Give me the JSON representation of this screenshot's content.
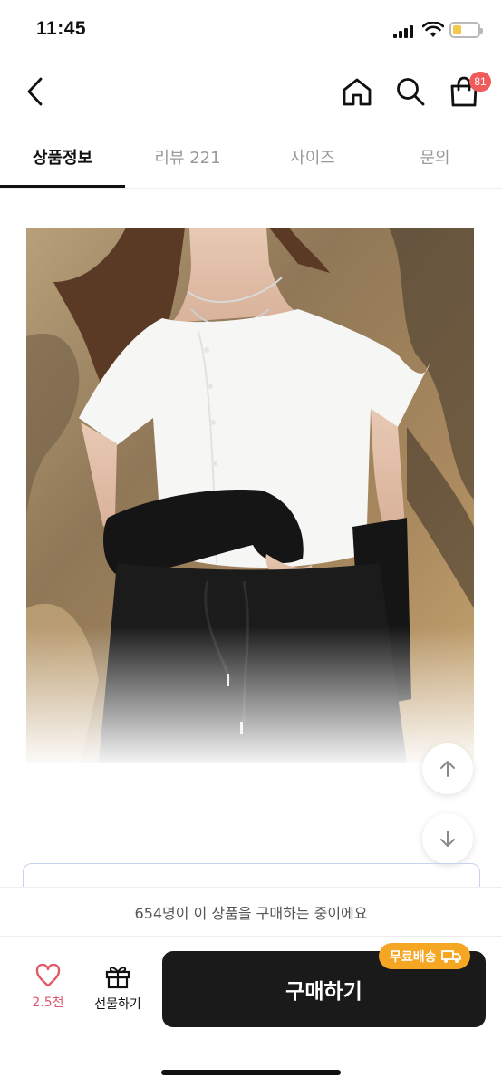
{
  "status_bar": {
    "time": "11:45"
  },
  "header": {
    "back_icon": "chevron-left-icon",
    "home_icon": "home-icon",
    "search_icon": "search-icon",
    "cart_icon": "shopping-bag-icon",
    "cart_badge": "81",
    "badge_color": "#f05a5a"
  },
  "tabs": [
    {
      "label": "상품정보",
      "active": true
    },
    {
      "label": "리뷰 221",
      "active": false
    },
    {
      "label": "사이즈",
      "active": false
    },
    {
      "label": "문의",
      "active": false
    }
  ],
  "product": {
    "image_icon": "product-photo"
  },
  "notice": {
    "text": "654명이 이 상품을 구매하는 중이에요"
  },
  "bottom_bar": {
    "like_count": "2.5천",
    "like_color": "#e0586b",
    "gift_label": "선물하기",
    "buy_label": "구매하기",
    "free_shipping_label": "무료배송",
    "free_shipping_color": "#f5a623"
  }
}
